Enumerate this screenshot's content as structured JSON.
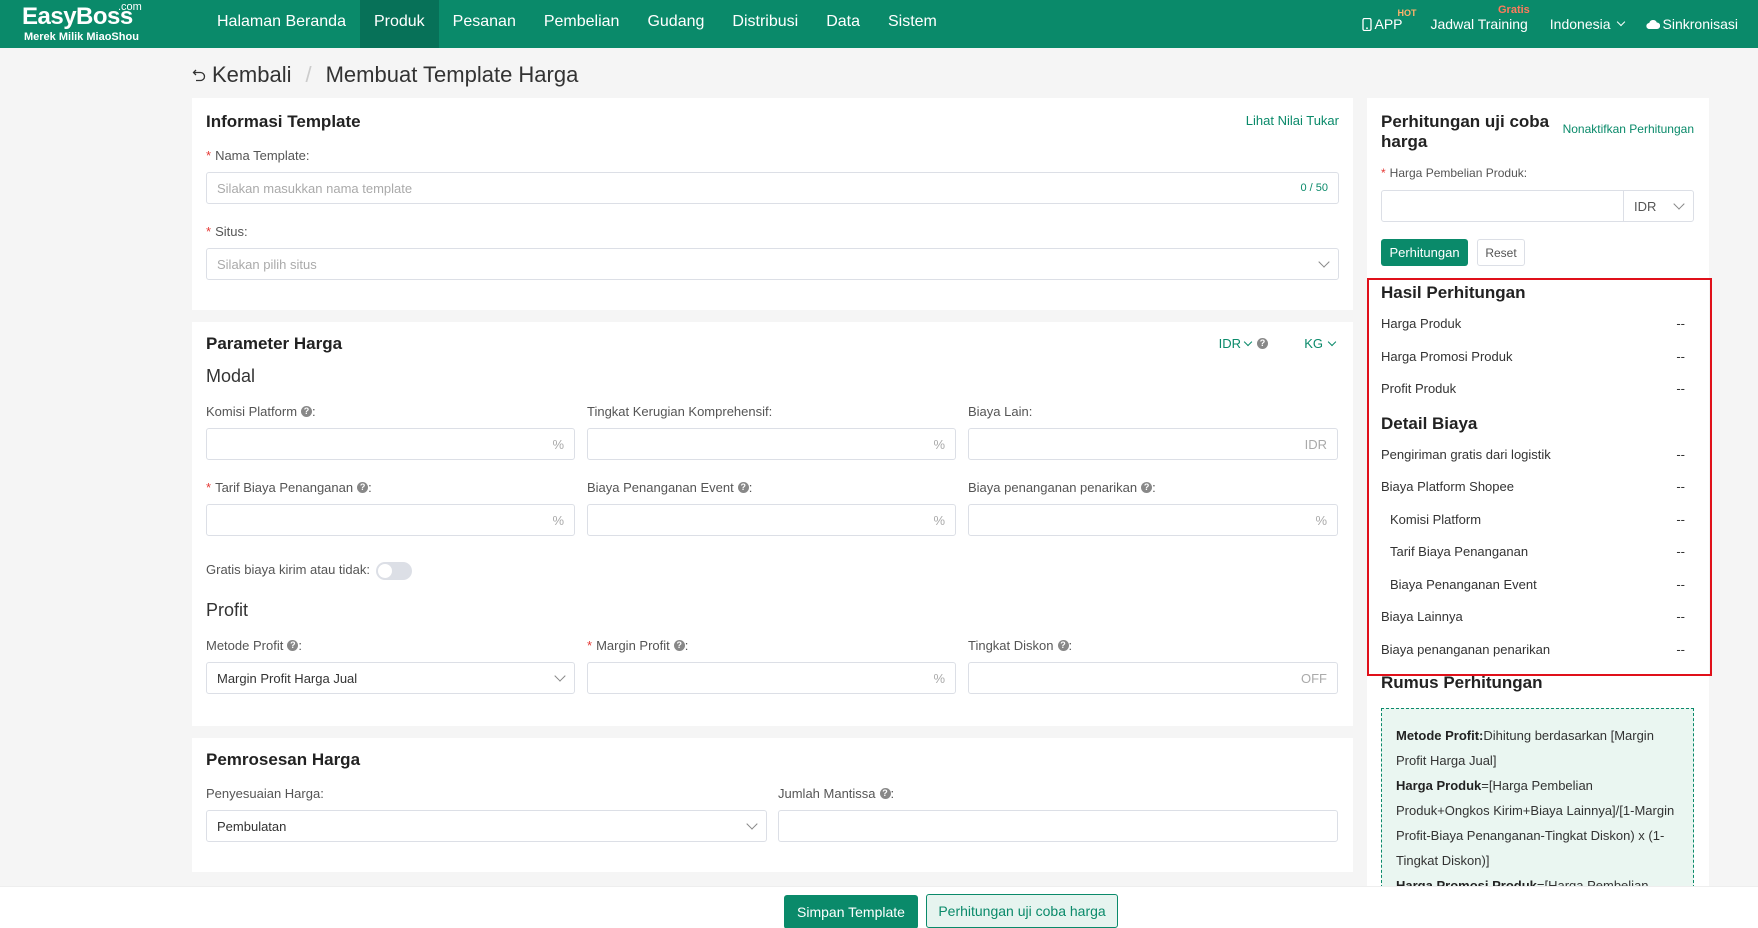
{
  "brand": {
    "name": "EasyBoss",
    "com": ".com",
    "subtitle": "Merek Milik MiaoShou"
  },
  "nav": {
    "items": [
      "Halaman Beranda",
      "Produk",
      "Pesanan",
      "Pembelian",
      "Gudang",
      "Distribusi",
      "Data",
      "Sistem"
    ],
    "active": "Produk",
    "right": {
      "app": "APP",
      "app_badge": "HOT",
      "training": "Jadwal Training",
      "training_badge": "Gratis",
      "language": "Indonesia",
      "sync": "Sinkronisasi"
    }
  },
  "breadcrumb": {
    "back": "Kembali",
    "separator": "/",
    "current": "Membuat Template Harga"
  },
  "template_info": {
    "title": "Informasi Template",
    "exchange_link": "Lihat Nilai Tukar",
    "name_label": "Nama Template:",
    "name_placeholder": "Silakan masukkan nama template",
    "name_counter": "0 / 50",
    "site_label": "Situs:",
    "site_placeholder": "Silakan pilih situs"
  },
  "price_params": {
    "title": "Parameter Harga",
    "currency": "IDR",
    "weight_unit": "KG",
    "modal_heading": "Modal",
    "fields": {
      "platform_commission": {
        "label": "Komisi Platform",
        "suffix": "%"
      },
      "loss_rate": {
        "label": "Tingkat Kerugian Komprehensif:",
        "suffix": "%"
      },
      "other_cost": {
        "label": "Biaya Lain:",
        "suffix": "IDR"
      },
      "handling_fee": {
        "label": "Tarif Biaya Penanganan",
        "suffix": "%"
      },
      "event_fee": {
        "label": "Biaya Penanganan Event",
        "suffix": "%"
      },
      "withdraw_fee": {
        "label": "Biaya penanganan penarikan",
        "suffix": "%"
      }
    },
    "free_shipping_label": "Gratis biaya kirim atau tidak:",
    "free_shipping_on": false,
    "profit_heading": "Profit",
    "profit_method_label": "Metode Profit",
    "profit_method_value": "Margin Profit Harga Jual",
    "profit_margin_label": "Margin Profit",
    "profit_margin_suffix": "%",
    "discount_label": "Tingkat Diskon",
    "discount_suffix": "OFF"
  },
  "price_processing": {
    "title": "Pemrosesan Harga",
    "adjust_label": "Penyesuaian Harga:",
    "adjust_value": "Pembulatan",
    "mantissa_label": "Jumlah Mantissa"
  },
  "trial": {
    "title": "Perhitungan uji coba harga",
    "disable_link": "Nonaktifkan Perhitungan",
    "purchase_label": "Harga Pembelian Produk:",
    "currency": "IDR",
    "calc_button": "Perhitungan",
    "reset_button": "Reset",
    "result_title": "Hasil Perhitungan",
    "results": [
      {
        "label": "Harga Produk",
        "value": "--"
      },
      {
        "label": "Harga Promosi Produk",
        "value": "--"
      },
      {
        "label": "Profit Produk",
        "value": "--"
      }
    ],
    "detail_title": "Detail Biaya",
    "details": [
      {
        "label": "Pengiriman gratis dari logistik",
        "value": "--"
      },
      {
        "label": "Biaya Platform Shopee",
        "value": "--"
      },
      {
        "label": "Komisi Platform",
        "value": "--"
      },
      {
        "label": "Tarif Biaya Penanganan",
        "value": "--"
      },
      {
        "label": "Biaya Penanganan Event",
        "value": "--"
      },
      {
        "label": "Biaya Lainnya",
        "value": "--"
      },
      {
        "label": "Biaya penanganan penarikan",
        "value": "--"
      }
    ],
    "formula_title": "Rumus Perhitungan",
    "formula": {
      "method_key": "Metode Profit:",
      "method_text": "Dihitung berdasarkan [Margin Profit Harga Jual]",
      "price_key": "Harga Produk",
      "price_text": "=[Harga Pembelian Produk+Ongkos Kirim+Biaya Lainnya]/[1-Margin Profit-Biaya Penanganan-Tingkat Diskon) x (1-Tingkat Diskon)]",
      "promo_key": "Harga Promosi Produk",
      "promo_text": "=[Harga Pembelian"
    }
  },
  "footer": {
    "save": "Simpan Template",
    "test": "Perhitungan uji coba harga"
  },
  "colors": {
    "brand": "#0a8a6a",
    "highlight": "#e0101a"
  }
}
